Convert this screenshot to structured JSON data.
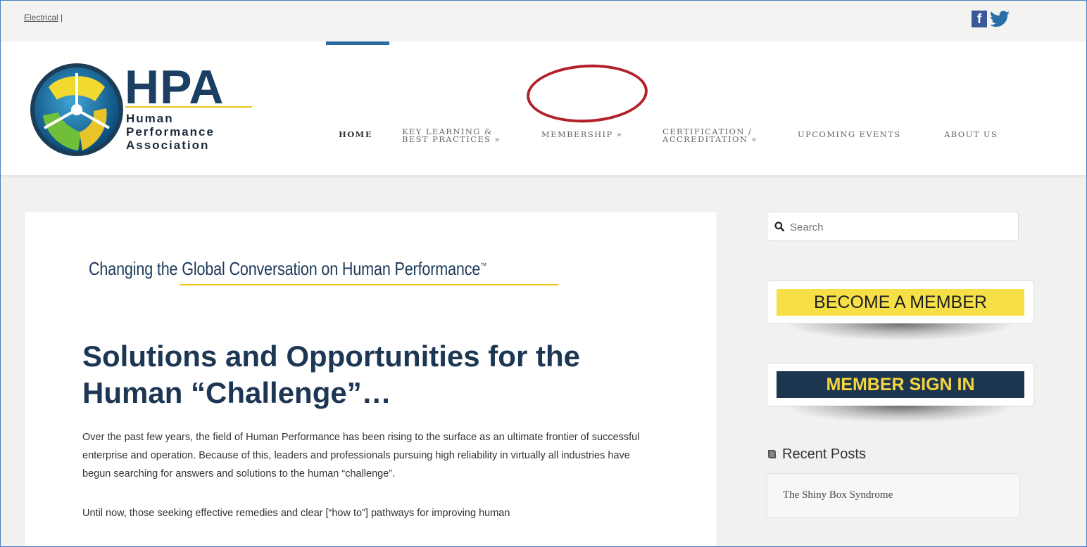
{
  "topbar": {
    "breadcrumb": "Electrical",
    "separator": "|"
  },
  "social": {
    "facebook_label": "f",
    "twitter_icon": "twitter-icon"
  },
  "logo": {
    "acronym": "HPA",
    "line1": "Human",
    "line2": "Performance",
    "line3": "Association"
  },
  "nav": {
    "items": [
      {
        "label": "HOME"
      },
      {
        "label": "KEY LEARNING &",
        "label2": "BEST PRACTICES »"
      },
      {
        "label": "MEMBERSHIP »"
      },
      {
        "label": "CERTIFICATION /",
        "label2": "ACCREDITATION »"
      },
      {
        "label": "UPCOMING EVENTS"
      },
      {
        "label": "ABOUT US"
      }
    ]
  },
  "content": {
    "tagline_a": "Changing",
    "tagline_b": " the Global Conversation on Human Performance",
    "tagline_tm": "™",
    "headline": "Solutions and Opportunities for the Human “Challenge”…",
    "paragraph1": "Over the past few years, the field of Human Performance has been rising to the surface as an ultimate frontier of successful enterprise and operation. Because of this, leaders and professionals pursuing high reliability in virtually all industries have begun searching for answers and solutions to the human “challenge”.",
    "paragraph2": "Until now, those seeking effective remedies and clear [“how to”] pathways for improving human"
  },
  "sidebar": {
    "search_placeholder": "Search",
    "become_member": "BECOME A MEMBER",
    "member_sign_in": "MEMBER SIGN IN",
    "recent_posts_title": "Recent Posts",
    "recent_posts": [
      "The Shiny Box Syndrome"
    ]
  },
  "colors": {
    "navy": "#1d3650",
    "yellow": "#f7e047",
    "accent_blue": "#2b6aa0",
    "annotation_red": "#b3202a"
  }
}
